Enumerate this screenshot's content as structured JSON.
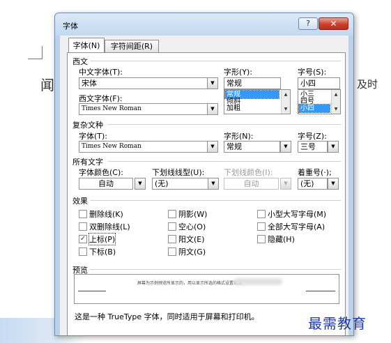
{
  "background": {
    "left_glyph": "闻",
    "right_text": "及时"
  },
  "dialog": {
    "title": "字体",
    "help_label": "?",
    "close_label": "✕",
    "tabs": [
      {
        "label": "字体(N)",
        "active": true
      },
      {
        "label": "字符间距(R)",
        "active": false
      }
    ]
  },
  "western": {
    "section": "西文",
    "chinese_font_label": "中文字体(T):",
    "chinese_font_value": "宋体",
    "western_font_label": "西文字体(F):",
    "western_font_value": "Times New Roman",
    "style_label": "字形(Y):",
    "style_value": "常规",
    "style_options": [
      "常规",
      "倾斜",
      "加粗"
    ],
    "style_selected": "常规",
    "size_label": "字号(S):",
    "size_value": "小四",
    "size_options": [
      "小三",
      "四号",
      "小四"
    ],
    "size_selected": "小四"
  },
  "complex": {
    "section": "复杂文种",
    "font_label": "字体(T):",
    "font_value": "Times New Roman",
    "style_label": "字形(N):",
    "style_value": "常规",
    "size_label": "字号(Z):",
    "size_value": "三号"
  },
  "all_text": {
    "section": "所有文字",
    "font_color_label": "字体颜色(C):",
    "font_color_value": "自动",
    "underline_style_label": "下划线线型(U):",
    "underline_style_value": "(无)",
    "underline_color_label": "下划线颜色(I):",
    "underline_color_value": "自动",
    "emphasis_label": "着重号(·);",
    "emphasis_value": "(无)"
  },
  "effects": {
    "section": "效果",
    "items": [
      {
        "label": "删除线(K)",
        "checked": false
      },
      {
        "label": "双删除线(L)",
        "checked": false
      },
      {
        "label": "上标(P)",
        "checked": true
      },
      {
        "label": "下标(B)",
        "checked": false
      },
      {
        "label": "阴影(W)",
        "checked": false
      },
      {
        "label": "空心(O)",
        "checked": false
      },
      {
        "label": "阳文(E)",
        "checked": false
      },
      {
        "label": "阴文(G)",
        "checked": false
      },
      {
        "label": "小型大写字母(M)",
        "checked": false
      },
      {
        "label": "全部大写字母(A)",
        "checked": false
      },
      {
        "label": "隐藏(H)",
        "checked": false
      }
    ]
  },
  "preview": {
    "section": "预览",
    "sample_text": "屏幕为示例预览所显示的，用以显示所选的格式设置效果"
  },
  "note": "这是一种 TrueType 字体，同时适用于屏幕和打印机。",
  "watermark": "最需教育"
}
